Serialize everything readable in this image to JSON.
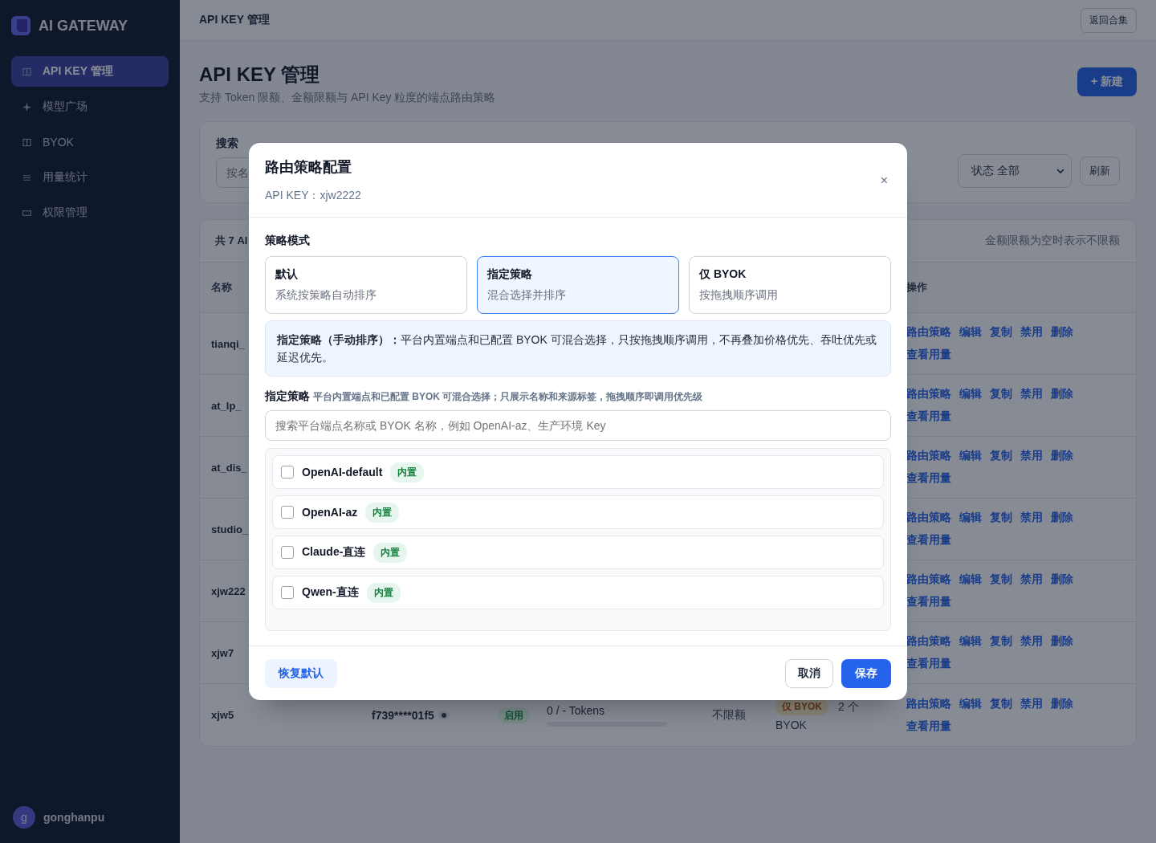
{
  "sidebar": {
    "brand": "AI GATEWAY",
    "items": [
      {
        "label": "API KEY 管理",
        "selected": true
      },
      {
        "label": "模型广场",
        "selected": false
      },
      {
        "label": "BYOK",
        "selected": false
      },
      {
        "label": "用量统计",
        "selected": false
      },
      {
        "label": "权限管理",
        "selected": false
      }
    ],
    "user": {
      "avatar": "g",
      "name": "gonghanpu"
    }
  },
  "topbar": {
    "title": "API KEY 管理",
    "back_button": "返回合集"
  },
  "page": {
    "title": "API KEY 管理",
    "subtitle": "支持 Token 限额、金额限额与 API Key 粒度的端点路由策略",
    "new_button": "+ 新建"
  },
  "filter": {
    "search_label": "搜索",
    "search_placeholder": "按名",
    "status_select": "状态 全部",
    "refresh_button": "刷新"
  },
  "table": {
    "count_text": "共 7 AI",
    "note": "金额限额为空时表示不限额",
    "columns": [
      "名称",
      "操作"
    ],
    "rows": [
      {
        "name": "tianqi_",
        "actions": [
          "路由策略",
          "编辑",
          "复制",
          "禁用",
          "删除",
          "查看用量"
        ]
      },
      {
        "name": "at_lp_",
        "actions": [
          "路由策略",
          "编辑",
          "复制",
          "禁用",
          "删除",
          "查看用量"
        ]
      },
      {
        "name": "at_dis_",
        "actions": [
          "路由策略",
          "编辑",
          "复制",
          "禁用",
          "删除",
          "查看用量"
        ]
      },
      {
        "name": "studio_",
        "actions": [
          "路由策略",
          "编辑",
          "复制",
          "禁用",
          "删除",
          "查看用量"
        ]
      },
      {
        "name": "xjw222",
        "actions": [
          "路由策略",
          "编辑",
          "复制",
          "禁用",
          "删除",
          "查看用量"
        ]
      },
      {
        "name": "xjw7",
        "actions": [
          "路由策略",
          "编辑",
          "复制",
          "禁用",
          "删除",
          "查看用量"
        ]
      },
      {
        "name": "xjw5",
        "key": "f739****01f5",
        "status": "启用",
        "usage": "0 / - Tokens",
        "amount": "不限额",
        "strategy_tag": "仅 BYOK",
        "strategy_count": "2 个",
        "strategy_sub": "BYOK",
        "actions": [
          "路由策略",
          "编辑",
          "复制",
          "禁用",
          "删除",
          "查看用量"
        ]
      }
    ]
  },
  "modal": {
    "title": "路由策略配置",
    "subtitle": "API KEY：xjw2222",
    "close": "×",
    "mode_label": "策略模式",
    "modes": [
      {
        "title": "默认",
        "desc": "系统按策略自动排序",
        "selected": false
      },
      {
        "title": "指定策略",
        "desc": "混合选择并排序",
        "selected": true
      },
      {
        "title": "仅 BYOK",
        "desc": "按拖拽顺序调用",
        "selected": false
      }
    ],
    "info": "**指定策略（手动排序）：**平台内置端点和已配置 BYOK 可混合选择，只按拖拽顺序调用，不再叠加价格优先、吞吐优先或延迟优先。",
    "list_label": "指定策略",
    "list_hint": "平台内置端点和已配置 BYOK 可混合选择；只展示名称和来源标签，拖拽顺序即调用优先级",
    "search_placeholder": "搜索平台端点名称或 BYOK 名称，例如 OpenAI-az、生产环境 Key",
    "items": [
      {
        "name": "OpenAI-default",
        "tag": "内置",
        "checked": false
      },
      {
        "name": "OpenAI-az",
        "tag": "内置",
        "checked": false
      },
      {
        "name": "Claude-直连",
        "tag": "内置",
        "checked": false
      },
      {
        "name": "Qwen-直连",
        "tag": "内置",
        "checked": false
      }
    ],
    "reset_button": "恢复默认",
    "cancel_button": "取消",
    "save_button": "保存"
  }
}
